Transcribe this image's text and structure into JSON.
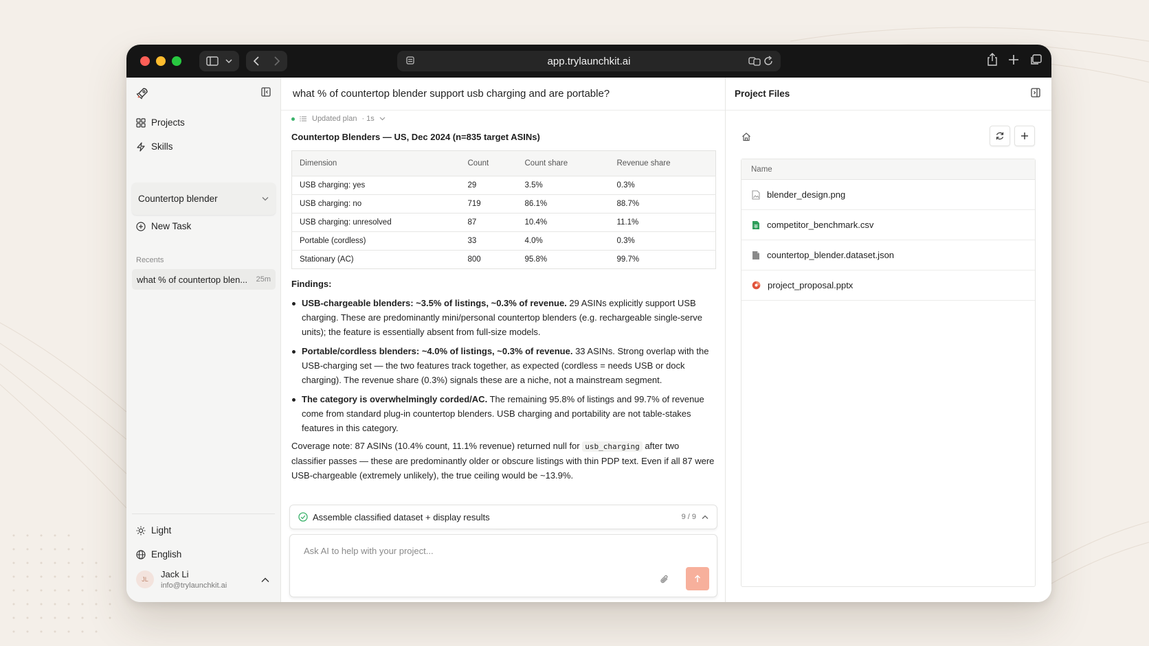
{
  "browser": {
    "url": "app.trylaunchkit.ai"
  },
  "sidebar": {
    "nav": [
      {
        "label": "Projects",
        "icon": "grid-icon"
      },
      {
        "label": "Skills",
        "icon": "bolt-icon"
      }
    ],
    "project_select": "Countertop blender",
    "new_task_label": "New Task",
    "recents_label": "Recents",
    "recents": [
      {
        "title": "what % of countertop blen...",
        "time": "25m"
      }
    ],
    "theme_label": "Light",
    "language_label": "English",
    "user": {
      "initials": "JL",
      "name": "Jack Li",
      "email": "info@trylaunchkit.ai"
    }
  },
  "chat": {
    "title": "what % of countertop blender support usb charging and are portable?",
    "plan_status": "Updated plan",
    "plan_time": "· 1s",
    "section_title": "Countertop Blenders — US, Dec 2024 (n=835 target ASINs)",
    "table": {
      "headers": [
        "Dimension",
        "Count",
        "Count share",
        "Revenue share"
      ],
      "rows": [
        [
          "USB charging: yes",
          "29",
          "3.5%",
          "0.3%"
        ],
        [
          "USB charging: no",
          "719",
          "86.1%",
          "88.7%"
        ],
        [
          "USB charging: unresolved",
          "87",
          "10.4%",
          "11.1%"
        ],
        [
          "Portable (cordless)",
          "33",
          "4.0%",
          "0.3%"
        ],
        [
          "Stationary (AC)",
          "800",
          "95.8%",
          "99.7%"
        ]
      ]
    },
    "findings_title": "Findings:",
    "findings": [
      {
        "bold": "USB-chargeable blenders: ~3.5% of listings, ~0.3% of revenue.",
        "text": " 29 ASINs explicitly support USB charging. These are predominantly mini/personal countertop blenders (e.g. rechargeable single-serve units); the feature is essentially absent from full-size models."
      },
      {
        "bold": "Portable/cordless blenders: ~4.0% of listings, ~0.3% of revenue.",
        "text": " 33 ASINs. Strong overlap with the USB-charging set — the two features track together, as expected (cordless = needs USB or dock charging). The revenue share (0.3%) signals these are a niche, not a mainstream segment."
      },
      {
        "bold": "The category is overwhelmingly corded/AC.",
        "text": " The remaining 95.8% of listings and 99.7% of revenue come from standard plug-in countertop blenders. USB charging and portability are not table-stakes features in this category."
      }
    ],
    "coverage_pre": "Coverage note: 87 ASINs (10.4% count, 11.1% revenue) returned null for ",
    "coverage_code": "usb_charging",
    "coverage_post": " after two classifier passes — these are predominantly older or obscure listings with thin PDP text. Even if all 87 were USB-chargeable (extremely unlikely), the true ceiling would be ~13.9%.",
    "progress": {
      "label": "Assemble classified dataset + display results",
      "count": "9 / 9"
    },
    "composer_placeholder": "Ask AI to help with your project..."
  },
  "files_panel": {
    "title": "Project Files",
    "column": "Name",
    "files": [
      {
        "name": "blender_design.png",
        "icon": "image-file-icon",
        "color": "#9a9a9a"
      },
      {
        "name": "competitor_benchmark.csv",
        "icon": "spreadsheet-file-icon",
        "color": "#2e9e5b"
      },
      {
        "name": "countertop_blender.dataset.json",
        "icon": "document-file-icon",
        "color": "#8a8a8a"
      },
      {
        "name": "project_proposal.pptx",
        "icon": "presentation-file-icon",
        "color": "#e0533c"
      }
    ]
  },
  "colors": {
    "accent_send": "#f7b09c",
    "status_green": "#3bb26b"
  }
}
